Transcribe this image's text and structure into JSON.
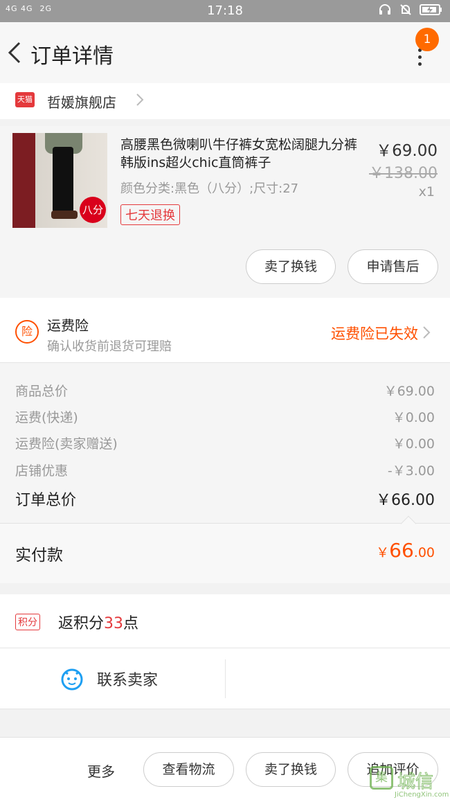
{
  "status_bar": {
    "signal_left": "4G 4G",
    "signal_right": "2G",
    "time": "17:18"
  },
  "header": {
    "title": "订单详情",
    "badge_count": "1"
  },
  "shop": {
    "logo_text": "天猫",
    "name": "哲媛旗舰店"
  },
  "item": {
    "title": "高腰黑色微喇叭牛仔裤女宽松阔腿九分裤韩版ins超火chic直筒裤子",
    "spec": "颜色分类:黑色（八分）;尺寸:27",
    "thumb_tag": "八分",
    "refund_tag": "七天退换",
    "price": "￥69.00",
    "original_price": "￥138.00",
    "quantity": "x1",
    "buttons": {
      "sell_for_cash": "卖了换钱",
      "after_sale": "申请售后"
    }
  },
  "insurance": {
    "icon_text": "险",
    "title": "运费险",
    "subtitle": "确认收货前退货可理赔",
    "status": "运费险已失效"
  },
  "costs": {
    "rows": [
      {
        "label": "商品总价",
        "value": "￥69.00"
      },
      {
        "label": "运费(快递)",
        "value": "￥0.00"
      },
      {
        "label": "运费险(卖家赠送)",
        "value": "￥0.00"
      },
      {
        "label": "店铺优惠",
        "value": "-￥3.00"
      }
    ],
    "total_label": "订单总价",
    "total_value": "￥66.00"
  },
  "paid": {
    "label": "实付款",
    "currency": "￥",
    "amount_int": "66",
    "amount_dec": ".00"
  },
  "points": {
    "tag": "积分",
    "prefix": "返积分",
    "number": "33",
    "suffix": "点"
  },
  "contact": {
    "label": "联系卖家"
  },
  "footer": {
    "more": "更多",
    "logistics": "查看物流",
    "sell_for_cash": "卖了换钱",
    "add_review": "追加评价"
  },
  "watermark": {
    "cn": "城信",
    "en": "JiChengXin.com",
    "box": "集"
  },
  "colors": {
    "accent": "#ff5000",
    "brand_red": "#e4393c",
    "badge": "#ff6a00"
  }
}
